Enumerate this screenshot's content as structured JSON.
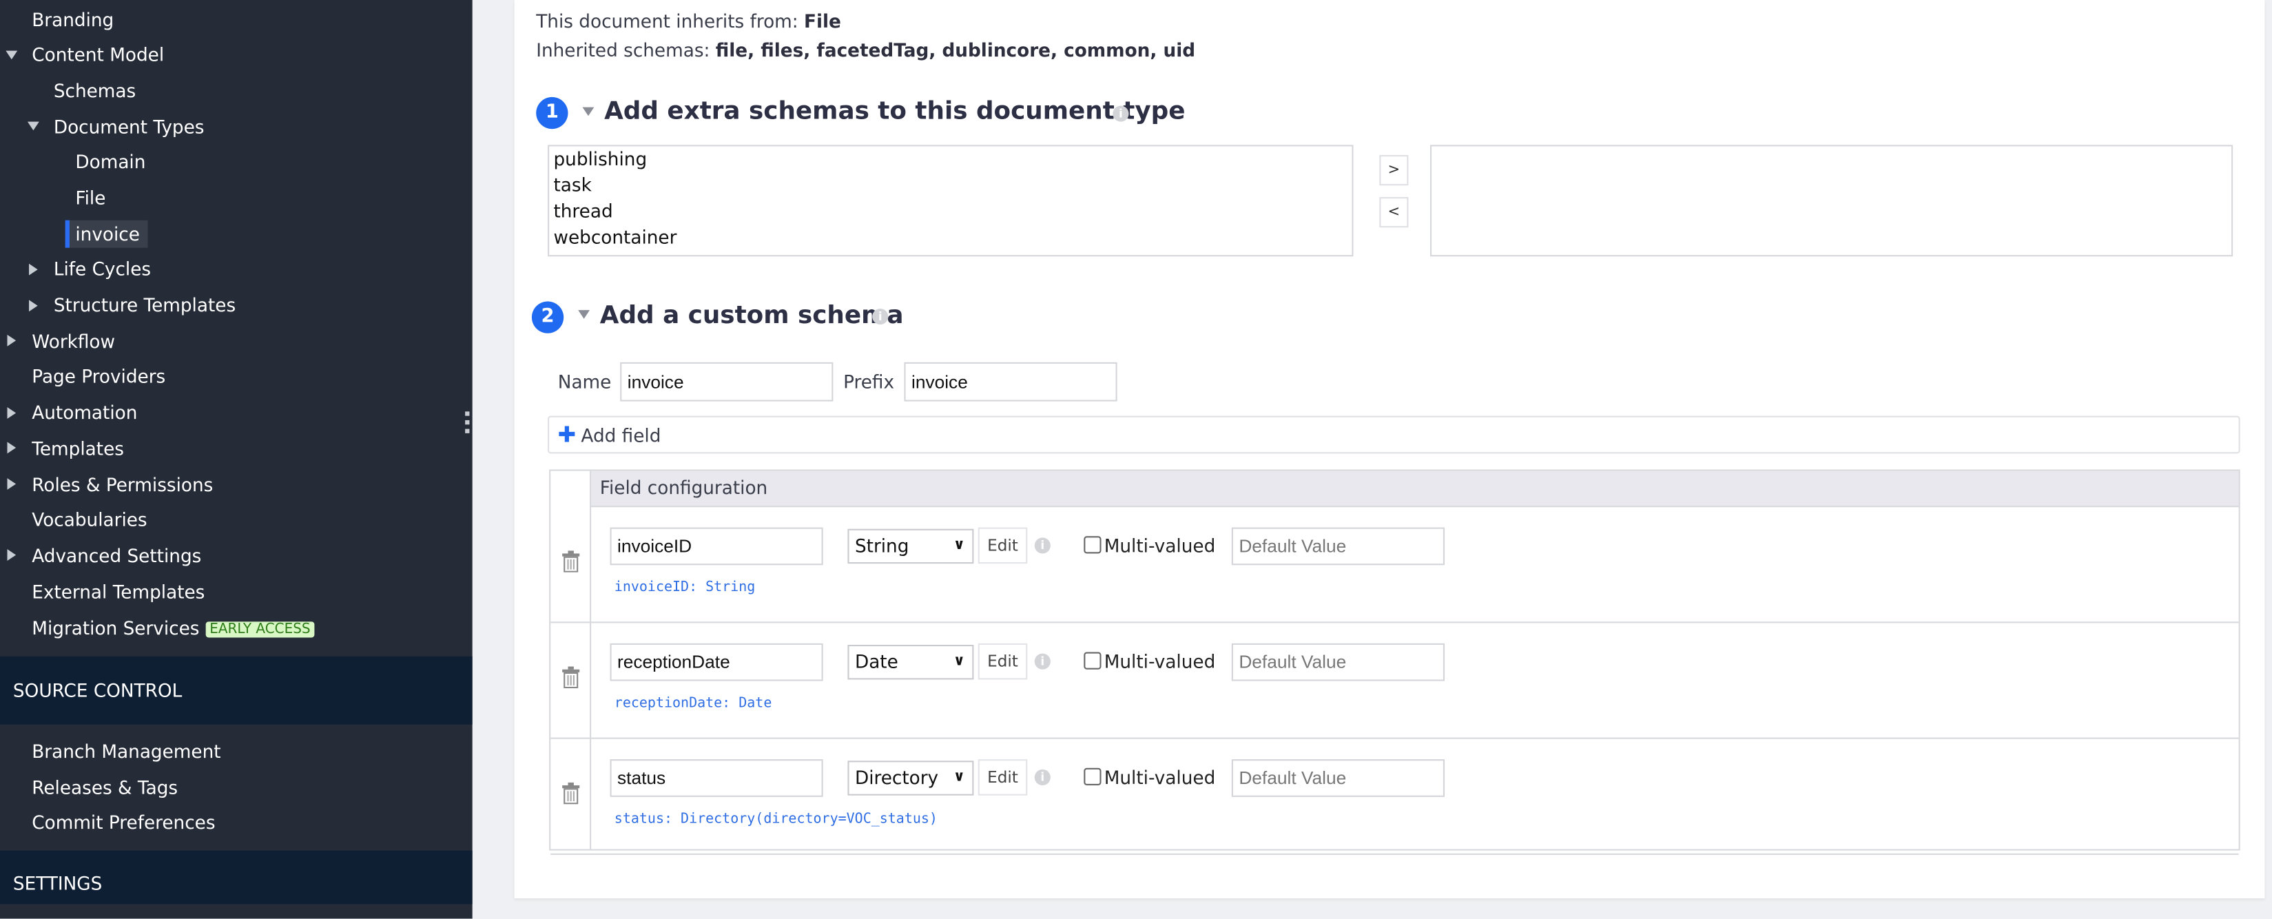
{
  "sidebar": {
    "items": [
      {
        "label": "Branding"
      },
      {
        "label": "Content Model"
      },
      {
        "label": "Schemas"
      },
      {
        "label": "Document Types"
      },
      {
        "label": "Domain"
      },
      {
        "label": "File"
      },
      {
        "label": "invoice"
      },
      {
        "label": "Life Cycles"
      },
      {
        "label": "Structure Templates"
      },
      {
        "label": "Workflow"
      },
      {
        "label": "Page Providers"
      },
      {
        "label": "Automation"
      },
      {
        "label": "Templates"
      },
      {
        "label": "Roles & Permissions"
      },
      {
        "label": "Vocabularies"
      },
      {
        "label": "Advanced Settings"
      },
      {
        "label": "External Templates"
      },
      {
        "label": "Migration Services",
        "badge": "EARLY ACCESS"
      }
    ],
    "source_control": {
      "title": "SOURCE CONTROL",
      "items": [
        {
          "label": "Branch Management"
        },
        {
          "label": "Releases & Tags"
        },
        {
          "label": "Commit Preferences"
        }
      ]
    },
    "settings": {
      "title": "SETTINGS"
    },
    "accent_color": "#2b6df2"
  },
  "main": {
    "inherits_label": "This document inherits from:",
    "inherits_value": "File",
    "schemas_label": "Inherited schemas:",
    "schemas_value": "file, files, facetedTag, dublincore, common, uid",
    "section1": {
      "number": "1",
      "title": "Add extra schemas to this document type",
      "available": [
        "publishing",
        "task",
        "thread",
        "webcontainer"
      ],
      "add_btn": ">",
      "remove_btn": "<"
    },
    "section2": {
      "number": "2",
      "title": "Add a custom schema",
      "name_label": "Name",
      "name_value": "invoice",
      "prefix_label": "Prefix",
      "prefix_value": "invoice",
      "add_field": "Add field",
      "table_header": "Field configuration",
      "fields": [
        {
          "name": "invoiceID",
          "type": "String",
          "edit": "Edit",
          "multi": "Multi-valued",
          "default_placeholder": "Default Value",
          "summary": "invoiceID: String"
        },
        {
          "name": "receptionDate",
          "type": "Date",
          "edit": "Edit",
          "multi": "Multi-valued",
          "default_placeholder": "Default Value",
          "summary": "receptionDate: Date"
        },
        {
          "name": "status",
          "type": "Directory",
          "edit": "Edit",
          "multi": "Multi-valued",
          "default_placeholder": "Default Value",
          "summary": "status: Directory(directory=VOC_status)"
        }
      ]
    }
  }
}
